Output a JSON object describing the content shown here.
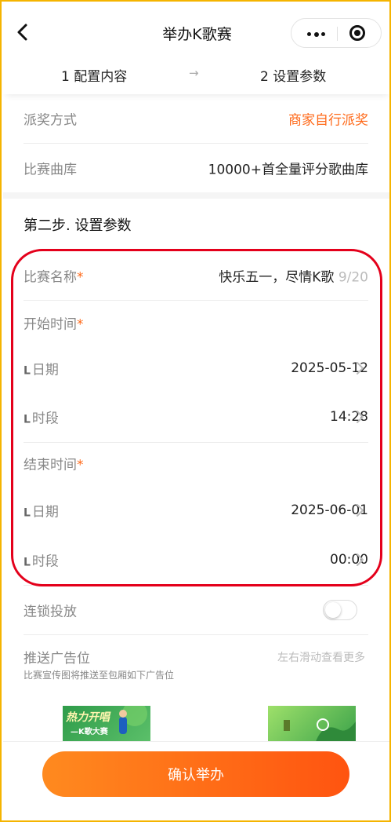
{
  "nav": {
    "title": "举办K歌赛"
  },
  "steps": {
    "step1": "1 配置内容",
    "arrow": "→",
    "step2": "2 设置参数"
  },
  "award": {
    "label": "派奖方式",
    "value": "商家自行派奖"
  },
  "library": {
    "label": "比赛曲库",
    "value": "10000+首全量评分歌曲库"
  },
  "section": {
    "title": "第二步. 设置参数"
  },
  "contest_name": {
    "label": "比赛名称",
    "required": "*",
    "value": "快乐五一，尽情K歌",
    "counter": "9/20"
  },
  "start": {
    "label": "开始时间",
    "required": "*",
    "date_label": "日期",
    "date_value": "2025-05-12",
    "time_label": "时段",
    "time_value": "14:28"
  },
  "end": {
    "label": "结束时间",
    "required": "*",
    "date_label": "日期",
    "date_value": "2025-06-01",
    "time_label": "时段",
    "time_value": "00:00"
  },
  "sub_marker": "L",
  "chain": {
    "label": "连锁投放",
    "enabled": false
  },
  "ad": {
    "title": "推送广告位",
    "subtitle": "比赛宣传图将推送至包厢如下广告位",
    "hint": "左右滑动查看更多"
  },
  "thumb1": {
    "line1": "热力开唱",
    "line2": "—K歌大赛"
  },
  "cta": {
    "label": "确认举办"
  },
  "colors": {
    "accent": "#ff6a1a",
    "cta_start": "#ff8a1f",
    "cta_end": "#ff5410",
    "highlight": "#e4001b",
    "frame": "#f5b400"
  },
  "icons": {
    "back": "back-chevron-icon",
    "more": "more-dots-icon",
    "close": "target-circle-icon",
    "chevron": "chevron-right-icon"
  }
}
